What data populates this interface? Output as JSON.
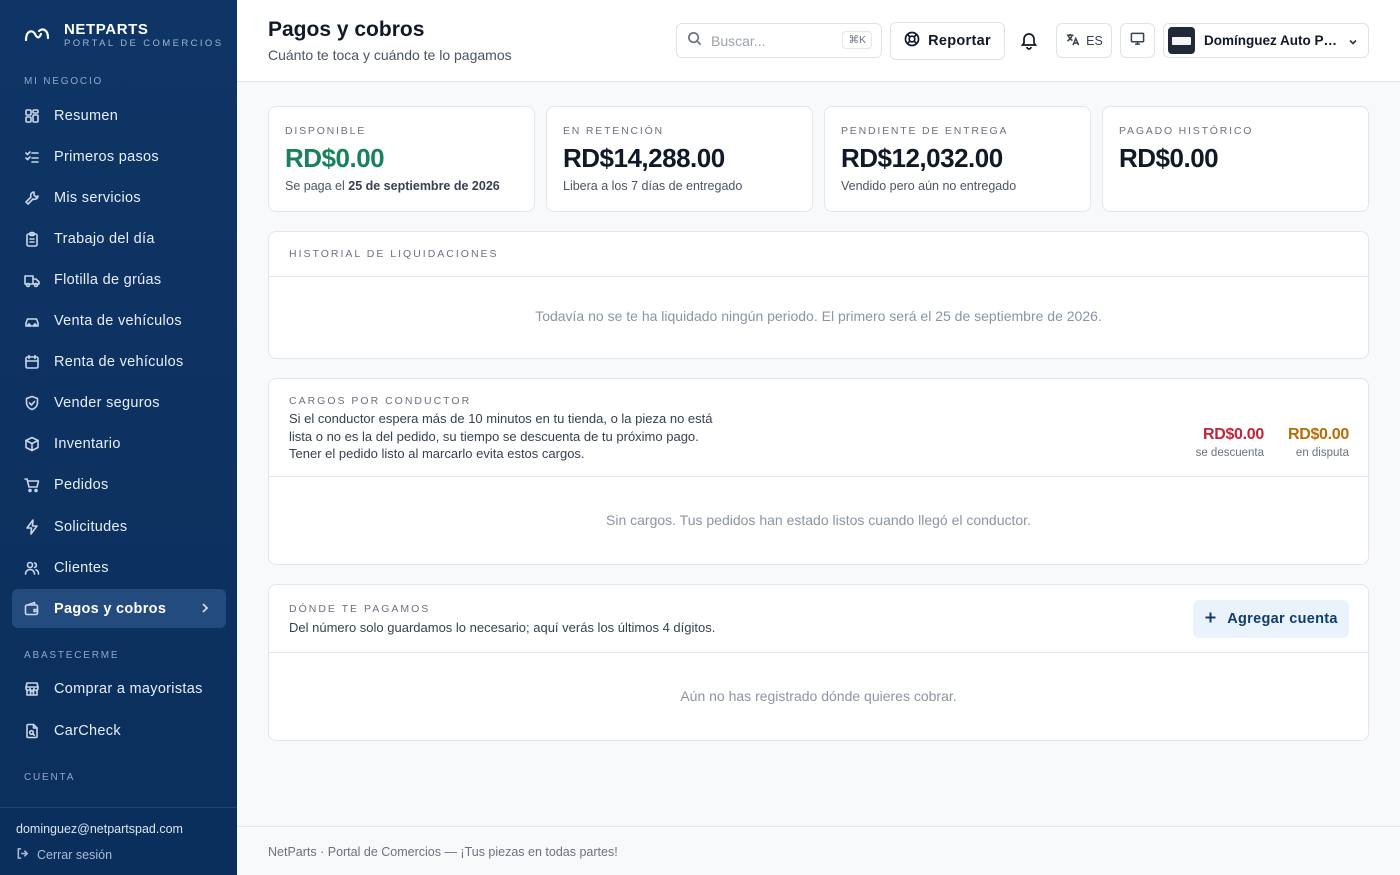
{
  "brand": {
    "name": "NETPARTS",
    "subtitle": "PORTAL DE COMERCIOS"
  },
  "sidebar": {
    "sections": {
      "mi_negocio": "MI NEGOCIO",
      "abastecerme": "ABASTECERME",
      "cuenta": "CUENTA"
    },
    "items": [
      {
        "label": "Resumen",
        "icon": "dashboard-icon"
      },
      {
        "label": "Primeros pasos",
        "icon": "checklist-icon"
      },
      {
        "label": "Mis servicios",
        "icon": "wrench-icon"
      },
      {
        "label": "Trabajo del día",
        "icon": "clipboard-icon"
      },
      {
        "label": "Flotilla de grúas",
        "icon": "truck-icon"
      },
      {
        "label": "Venta de vehículos",
        "icon": "car-icon"
      },
      {
        "label": "Renta de vehículos",
        "icon": "calendar-icon"
      },
      {
        "label": "Vender seguros",
        "icon": "shield-icon"
      },
      {
        "label": "Inventario",
        "icon": "box-icon"
      },
      {
        "label": "Pedidos",
        "icon": "cart-icon"
      },
      {
        "label": "Solicitudes",
        "icon": "bolt-icon"
      },
      {
        "label": "Clientes",
        "icon": "users-icon"
      },
      {
        "label": "Pagos y cobros",
        "icon": "wallet-icon",
        "active": true
      },
      {
        "label": "Comprar a mayoristas",
        "icon": "store-icon"
      },
      {
        "label": "CarCheck",
        "icon": "document-search-icon"
      }
    ],
    "user_email": "dominguez@netpartspad.com",
    "logout_label": "Cerrar sesión"
  },
  "header": {
    "title": "Pagos y cobros",
    "subtitle": "Cuánto te toca y cuándo te lo pagamos",
    "search_placeholder": "Buscar...",
    "search_shortcut": "⌘K",
    "report_label": "Reportar",
    "language": "ES",
    "account_name": "Domínguez Auto Parts"
  },
  "stats": [
    {
      "label": "DISPONIBLE",
      "value": "RD$0.00",
      "note_prefix": "Se paga el ",
      "note_bold": "25 de septiembre de 2026",
      "accent": "#18825a"
    },
    {
      "label": "EN RETENCIÓN",
      "value": "RD$14,288.00",
      "note_prefix": "Libera a los 7 días de entregado",
      "note_bold": ""
    },
    {
      "label": "PENDIENTE DE ENTREGA",
      "value": "RD$12,032.00",
      "note_prefix": "Vendido pero aún no entregado",
      "note_bold": ""
    },
    {
      "label": "PAGADO HISTÓRICO",
      "value": "RD$0.00",
      "note_prefix": "",
      "note_bold": ""
    }
  ],
  "historial": {
    "label": "HISTORIAL DE LIQUIDACIONES",
    "empty": "Todavía no se te ha liquidado ningún periodo. El primero será el 25 de septiembre de 2026."
  },
  "cargos": {
    "label": "CARGOS POR CONDUCTOR",
    "description": "Si el conductor espera más de 10 minutos en tu tienda, o la pieza no está lista o no es la del pedido, su tiempo se descuenta de tu próximo pago. Tener el pedido listo al marcarlo evita estos cargos.",
    "descuenta_value": "RD$0.00",
    "descuenta_label": "se descuenta",
    "disputa_value": "RD$0.00",
    "disputa_label": "en disputa",
    "empty": "Sin cargos. Tus pedidos han estado listos cuando llegó el conductor.",
    "colors": {
      "descuenta": "#c0263a",
      "disputa": "#b86e06"
    }
  },
  "pagos": {
    "label": "DÓNDE TE PAGAMOS",
    "description": "Del número solo guardamos lo necesario; aquí verás los últimos 4 dígitos.",
    "add_label": "Agregar cuenta",
    "empty": "Aún no has registrado dónde quieres cobrar."
  },
  "footer": {
    "text": "NetParts · Portal de Comercios — ¡Tus piezas en todas partes!"
  }
}
